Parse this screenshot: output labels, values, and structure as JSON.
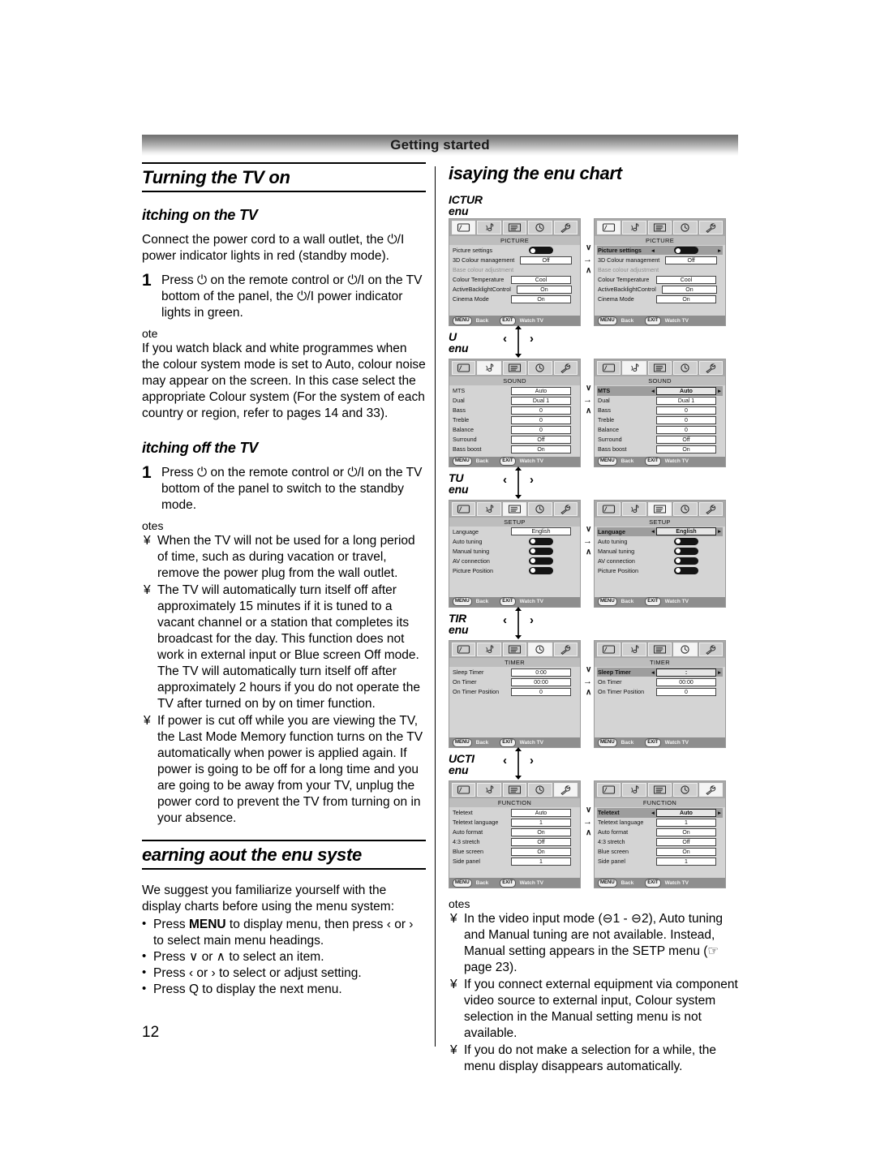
{
  "header": {
    "title": "Getting started"
  },
  "page_number": "12",
  "left_column": {
    "section1_title": "Turning the TV on",
    "sub1_title": "itching on the TV",
    "intro": "Connect the power cord to a wall outlet, the ⏻/I power indicator lights in red (standby mode).",
    "step1_num": "1",
    "step1_text": "Press ⏻ on the remote control or ⏻/I on the TV bottom of the panel, the ⏻/I power indicator lights in green.",
    "note_label": "ote",
    "note_text": "If you watch black and white programmes when the colour system mode is set to Auto, colour noise may appear on the screen. In this case select the appropriate Colour system (For the system of each country or region, refer to pages 14 and 33).",
    "sub2_title": "itching off the TV",
    "step2_num": "1",
    "step2_text": "Press ⏻ on the remote control or ⏻/I on the TV bottom of the panel to switch to the standby mode.",
    "notes_label": "otes",
    "notes": [
      "When the TV will not be used for a long period of time, such as during vacation or travel, remove the power plug from the wall outlet.",
      "The TV will automatically turn itself off after approximately 15 minutes if it is tuned to a vacant channel or a station that completes its broadcast for the day. This function does not work in external input or Blue screen Off mode. The TV will automatically turn itself off after approximately 2 hours if you do not operate the TV after turned on by on timer function.",
      "If power is cut off while you are viewing the TV, the Last Mode Memory function turns on the TV automatically when power is applied again. If power is going to be off for a long time and you are going to be away from your TV, unplug the power cord to prevent the TV from turning on in your absence."
    ],
    "note_bullet": "¥",
    "section2_title": "earning aout the enu syste",
    "menu_intro": "We suggest you familiarize yourself with the display charts before using the menu system:",
    "menu_bullets": [
      {
        "pre": "Press ",
        "bold": "MENU",
        "post": "  to display menu, then press ‹ or › to select main menu headings."
      },
      {
        "pre": "Press ",
        "bold": "",
        "post": "∨ or ∧ to select an item."
      },
      {
        "pre": "Press ",
        "bold": "",
        "post": "‹ or › to select or adjust setting."
      },
      {
        "pre": "Press ",
        "bold": "",
        "post": "Q  to display the next menu."
      }
    ],
    "dot": "•"
  },
  "right_column": {
    "title": "isaying the enu chart",
    "icons": [
      "picture-icon",
      "sound-icon",
      "setup-icon",
      "timer-icon",
      "function-icon"
    ],
    "menus": [
      {
        "label_line1": "ICTUR",
        "label_line2": "enu",
        "screen_title": "PICTURE",
        "active_icon": 0,
        "nav": {
          "left": "‹",
          "right": "›"
        },
        "show_nav": false,
        "rows": [
          {
            "name": "Picture settings",
            "value": "",
            "type": "pill"
          },
          {
            "name": "3D Colour management",
            "value": "Off",
            "type": "box"
          },
          {
            "name": "Base colour adjustment",
            "value": "",
            "type": "none",
            "disabled": true
          },
          {
            "name": "Colour Temperature",
            "value": "Cool",
            "type": "box"
          },
          {
            "name": "ActiveBacklightControl",
            "value": "On",
            "type": "box"
          },
          {
            "name": "Cinema Mode",
            "value": "On",
            "type": "box"
          }
        ],
        "highlight_index": 0
      },
      {
        "label_line1": "U",
        "label_line2": "enu",
        "screen_title": "SOUND",
        "active_icon": 1,
        "nav": {
          "left": "‹",
          "right": "›"
        },
        "show_nav": true,
        "rows": [
          {
            "name": "MTS",
            "value": "Auto",
            "type": "box"
          },
          {
            "name": "Dual",
            "value": "Dual 1",
            "type": "box"
          },
          {
            "name": "Bass",
            "value": "0",
            "type": "box"
          },
          {
            "name": "Treble",
            "value": "0",
            "type": "box"
          },
          {
            "name": "Balance",
            "value": "0",
            "type": "box"
          },
          {
            "name": "Surround",
            "value": "Off",
            "type": "box"
          },
          {
            "name": "Bass boost",
            "value": "On",
            "type": "box"
          }
        ],
        "highlight_index": 0
      },
      {
        "label_line1": "TU",
        "label_line2": "enu",
        "screen_title": "SETUP",
        "active_icon": 2,
        "nav": {
          "left": "‹",
          "right": "›"
        },
        "show_nav": true,
        "rows": [
          {
            "name": "Language",
            "value": "English",
            "type": "box"
          },
          {
            "name": "Auto tuning",
            "value": "",
            "type": "pill"
          },
          {
            "name": "Manual tuning",
            "value": "",
            "type": "pill"
          },
          {
            "name": "AV connection",
            "value": "",
            "type": "pill"
          },
          {
            "name": "Picture Position",
            "value": "",
            "type": "pill"
          }
        ],
        "highlight_index": 0
      },
      {
        "label_line1": "TIR",
        "label_line2": "enu",
        "screen_title": "TIMER",
        "active_icon": 3,
        "nav": {
          "left": "‹",
          "right": "›"
        },
        "show_nav": true,
        "rows": [
          {
            "name": "Sleep Timer",
            "value": "0:00",
            "value_hl": ":",
            "type": "box"
          },
          {
            "name": "On Timer",
            "value": "00:00",
            "type": "box"
          },
          {
            "name": "On Timer Position",
            "value": "0",
            "type": "box"
          }
        ],
        "highlight_index": 0
      },
      {
        "label_line1": "UCTI",
        "label_line2": "enu",
        "screen_title": "FUNCTION",
        "active_icon": 4,
        "nav": {
          "left": "‹",
          "right": "›"
        },
        "show_nav": true,
        "rows": [
          {
            "name": "Teletext",
            "value": "Auto",
            "type": "box"
          },
          {
            "name": "Teletext language",
            "value": "1",
            "type": "box"
          },
          {
            "name": "Auto format",
            "value": "On",
            "type": "box"
          },
          {
            "name": "4:3 stretch",
            "value": "Off",
            "type": "box"
          },
          {
            "name": "Blue screen",
            "value": "On",
            "type": "box"
          },
          {
            "name": "Side panel",
            "value": "1",
            "type": "box"
          }
        ],
        "highlight_index": 0
      }
    ],
    "footbar": {
      "menu_key": "MENU",
      "menu_text": "Back",
      "exit_key": "EXIT",
      "exit_text": "Watch TV"
    },
    "notes_label": "otes",
    "note_bullet": "¥",
    "notes": [
      "In the video input mode (⊖1 - ⊖2), Auto tuning  and Manual tuning  are not available. Instead, Manual setting  appears in the SETP menu (☞ page 23).",
      "If you connect external equipment via component video source to external input, Colour system  selection in the Manual setting  menu is not available.",
      "If you do not make a selection for a while, the menu display disappears automatically."
    ]
  }
}
